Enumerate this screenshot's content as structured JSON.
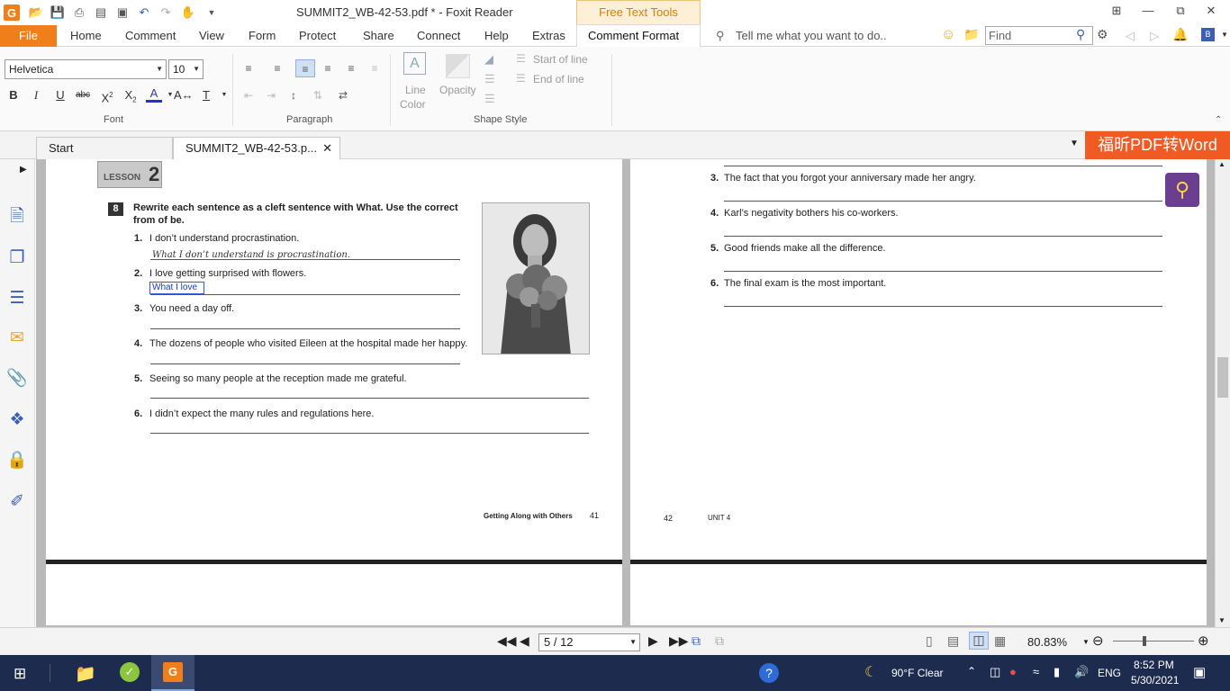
{
  "titlebar": {
    "title": "SUMMIT2_WB-42-53.pdf * - Foxit Reader",
    "context_tab": "Free Text Tools"
  },
  "menubar": {
    "file": "File",
    "items": [
      "Home",
      "Comment",
      "View",
      "Form",
      "Protect",
      "Share",
      "Connect",
      "Help",
      "Extras",
      "Comment Format"
    ],
    "tell_me": "Tell me what you want to do..",
    "find_placeholder": "Find"
  },
  "ribbon": {
    "font_name": "Helvetica",
    "font_size": "10",
    "font_group": "Font",
    "paragraph_group": "Paragraph",
    "shape_style_group": "Shape Style",
    "line_color": "Line",
    "line_color2": "Color",
    "opacity": "Opacity",
    "start_of_line": "Start of line",
    "end_of_line": "End of line"
  },
  "tabs": {
    "start": "Start",
    "document": "SUMMIT2_WB-42-53.p...",
    "promo": "福昕PDF转Word"
  },
  "page_left": {
    "lesson": "LESSON",
    "lesson_num": "2",
    "exercise_num": "8",
    "instruction_1": "Rewrite each sentence as a cleft sentence with What. Use the correct",
    "instruction_2": "from of be.",
    "questions": [
      {
        "num": "1.",
        "text": "I don’t understand procrastination.",
        "answer": "What I don’t understand is procrastination."
      },
      {
        "num": "2.",
        "text": "I love getting surprised with flowers.",
        "answer": "What I love"
      },
      {
        "num": "3.",
        "text": "You need a day off.",
        "answer": ""
      },
      {
        "num": "4.",
        "text": "The dozens of people who visited Eileen at the hospital made her happy.",
        "answer": ""
      },
      {
        "num": "5.",
        "text": "Seeing so many people at the reception made me grateful.",
        "answer": ""
      },
      {
        "num": "6.",
        "text": "I didn’t expect the many rules and regulations here.",
        "answer": ""
      }
    ],
    "footer_title": "Getting Along with Others",
    "footer_page": "41"
  },
  "page_right": {
    "questions": [
      {
        "num": "3.",
        "text": "The fact that you forgot your anniversary made her angry."
      },
      {
        "num": "4.",
        "text": "Karl’s negativity bothers his co-workers."
      },
      {
        "num": "5.",
        "text": "Good friends make all the difference."
      },
      {
        "num": "6.",
        "text": "The final exam is the most important."
      }
    ],
    "footer_page": "42",
    "footer_unit": "UNIT 4"
  },
  "statusbar": {
    "page_indicator": "5 / 12",
    "zoom": "80.83%"
  },
  "taskbar": {
    "weather": "90°F  Clear",
    "language": "ENG",
    "time": "8:52 PM",
    "date": "5/30/2021"
  }
}
